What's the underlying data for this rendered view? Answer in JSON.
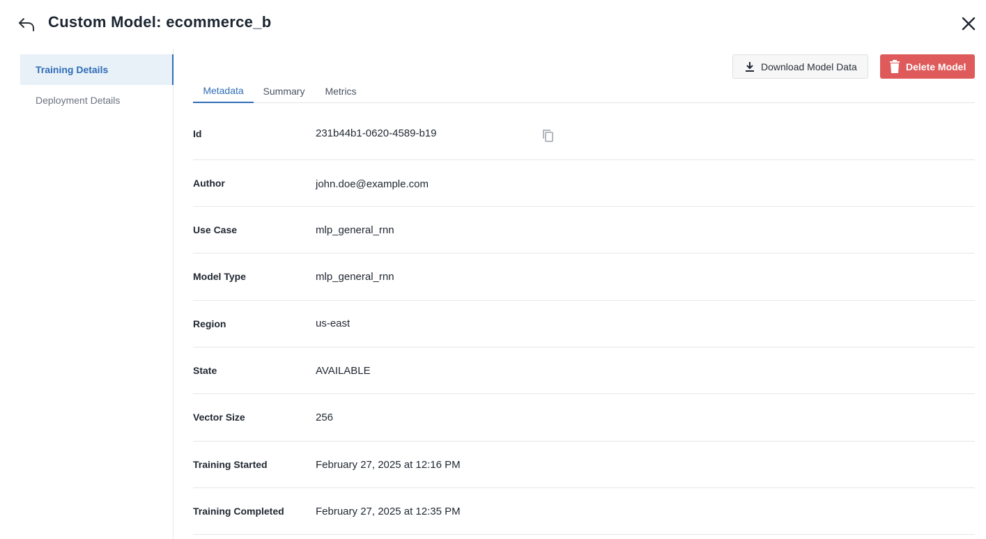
{
  "header": {
    "title": "Custom Model: ecommerce_b",
    "back_icon": "undo-arrow-icon",
    "close_icon": "close-icon"
  },
  "sidebar": {
    "items": [
      {
        "label": "Training Details",
        "active": true
      },
      {
        "label": "Deployment Details",
        "active": false
      }
    ]
  },
  "toolbar": {
    "download_label": "Download Model Data",
    "download_icon": "download-icon",
    "delete_label": "Delete Model",
    "delete_icon": "trash-icon",
    "delete_color": "#df5b5b"
  },
  "tabs": [
    {
      "label": "Metadata",
      "active": true
    },
    {
      "label": "Summary",
      "active": false
    },
    {
      "label": "Metrics",
      "active": false
    }
  ],
  "metadata": {
    "rows": [
      {
        "label": "Id",
        "value": "231b44b1-0620-4589-b19"
      },
      {
        "label": "Author",
        "value": "john.doe@example.com"
      },
      {
        "label": "Use Case",
        "value": "mlp_general_rnn"
      },
      {
        "label": "Model Type",
        "value": "mlp_general_rnn"
      },
      {
        "label": "Region",
        "value": "us-east"
      },
      {
        "label": "State",
        "value": "AVAILABLE"
      },
      {
        "label": "Vector Size",
        "value": "256"
      },
      {
        "label": "Training Started",
        "value": "February 27, 2025 at 12:16 PM"
      },
      {
        "label": "Training Completed",
        "value": "February 27, 2025 at 12:35 PM"
      }
    ]
  },
  "colors": {
    "accent": "#2d6db5",
    "active_bg": "#e8f0f8"
  }
}
